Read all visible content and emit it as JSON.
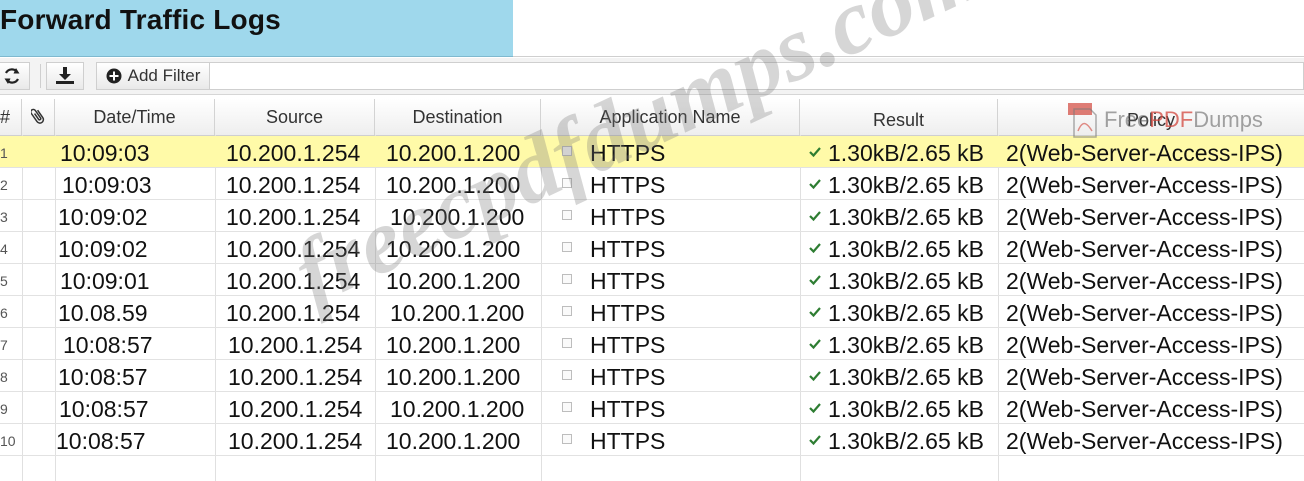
{
  "window": {
    "title": "Forward Traffic Logs"
  },
  "toolbar": {
    "refresh_icon": "refresh-icon",
    "download_icon": "download-icon",
    "add_filter_label": "Add Filter"
  },
  "table": {
    "columns": [
      "#",
      "",
      "Date/Time",
      "Source",
      "Destination",
      "Application Name",
      "Result",
      "Policy"
    ],
    "rows": [
      {
        "num": "1",
        "time": "10:09:03",
        "source": "10.200.1.254",
        "destination": "10.200.1.200",
        "app": "HTTPS",
        "result": "1.30kB/2.65 kB",
        "policy": "2(Web-Server-Access-IPS)"
      },
      {
        "num": "2",
        "time": "10:09:03",
        "source": "10.200.1.254",
        "destination": "10.200.1.200",
        "app": "HTTPS",
        "result": "1.30kB/2.65 kB",
        "policy": "2(Web-Server-Access-IPS)"
      },
      {
        "num": "3",
        "time": "10:09:02",
        "source": "10.200.1.254",
        "destination": "10.200.1.200",
        "app": "HTTPS",
        "result": "1.30kB/2.65 kB",
        "policy": "2(Web-Server-Access-IPS)"
      },
      {
        "num": "4",
        "time": "10:09:02",
        "source": "10.200.1.254",
        "destination": "10.200.1.200",
        "app": "HTTPS",
        "result": "1.30kB/2.65 kB",
        "policy": "2(Web-Server-Access-IPS)"
      },
      {
        "num": "5",
        "time": "10:09:01",
        "source": "10.200.1.254",
        "destination": "10.200.1.200",
        "app": "HTTPS",
        "result": "1.30kB/2.65 kB",
        "policy": "2(Web-Server-Access-IPS)"
      },
      {
        "num": "6",
        "time": "10.08.59",
        "source": "10.200.1.254",
        "destination": "10.200.1.200",
        "app": "HTTPS",
        "result": "1.30kB/2.65 kB",
        "policy": "2(Web-Server-Access-IPS)"
      },
      {
        "num": "7",
        "time": "10:08:57",
        "source": "10.200.1.254",
        "destination": "10.200.1.200",
        "app": "HTTPS",
        "result": "1.30kB/2.65 kB",
        "policy": "2(Web-Server-Access-IPS)"
      },
      {
        "num": "8",
        "time": "10:08:57",
        "source": "10.200.1.254",
        "destination": "10.200.1.200",
        "app": "HTTPS",
        "result": "1.30kB/2.65 kB",
        "policy": "2(Web-Server-Access-IPS)"
      },
      {
        "num": "9",
        "time": "10:08:57",
        "source": "10.200.1.254",
        "destination": "10.200.1.200",
        "app": "HTTPS",
        "result": "1.30kB/2.65 kB",
        "policy": "2(Web-Server-Access-IPS)"
      },
      {
        "num": "10",
        "time": "10:08:57",
        "source": "10.200.1.254",
        "destination": "10.200.1.200",
        "app": "HTTPS",
        "result": "1.30kB/2.65 kB",
        "policy": "2(Web-Server-Access-IPS)"
      }
    ],
    "selected_row": 0
  },
  "watermark": {
    "text": "freecpdfdumps.com",
    "logo_text_a": "Free",
    "logo_text_b": "PDF",
    "logo_text_c": "Dumps"
  },
  "colors": {
    "title_bg": "#9fd8ec",
    "selected_row": "#fffaa8",
    "result_check": "#2e7d32"
  }
}
